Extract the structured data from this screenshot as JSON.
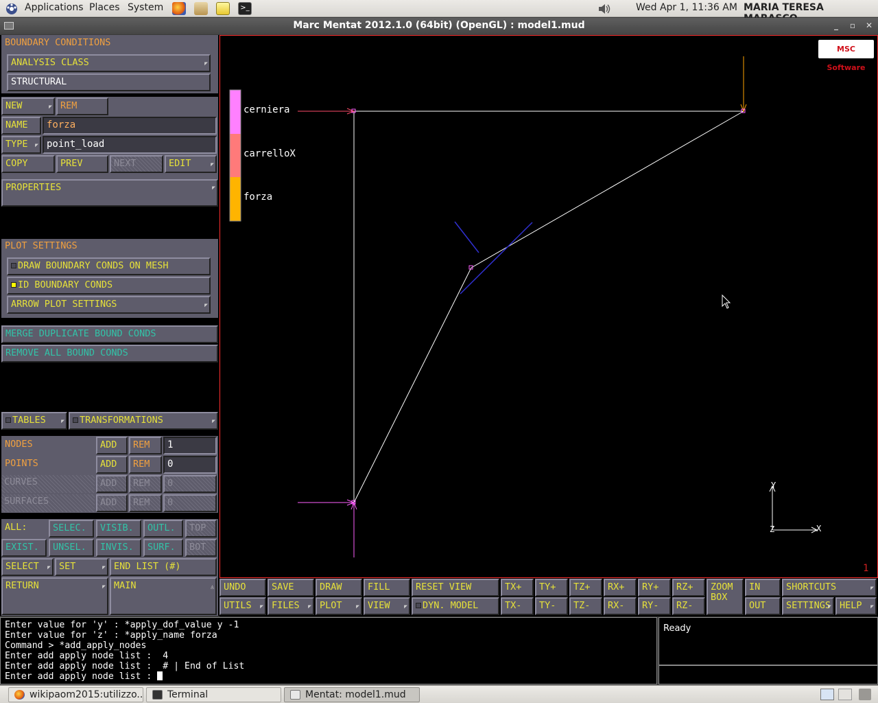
{
  "top_panel": {
    "menus": [
      "Applications",
      "Places",
      "System"
    ],
    "clock": "Wed Apr  1, 11:36 AM",
    "user": "MARIA TERESA MARASCO",
    "launchers": [
      "firefox-icon",
      "file-manager-icon",
      "text-editor-icon",
      "terminal-icon"
    ]
  },
  "window": {
    "title": "Marc Mentat 2012.1.0 (64bit) (OpenGL) : model1.mud"
  },
  "panel": {
    "header": "BOUNDARY CONDITIONS",
    "analysis_class_label": "ANALYSIS CLASS",
    "analysis_class_value": "STRUCTURAL",
    "new": "NEW",
    "rem": "REM",
    "name_label": "NAME",
    "name_value": "forza",
    "type_label": "TYPE",
    "type_value": "point_load",
    "copy": "COPY",
    "prev": "PREV",
    "next": "NEXT",
    "edit": "EDIT",
    "properties": "PROPERTIES",
    "plot_settings": "PLOT SETTINGS",
    "draw_bc": "DRAW BOUNDARY CONDS ON MESH",
    "id_bc": "ID BOUNDARY CONDS",
    "arrow_plot": "ARROW PLOT SETTINGS",
    "merge_dup": "MERGE DUPLICATE BOUND CONDS",
    "remove_all": "REMOVE ALL BOUND CONDS",
    "tables": "TABLES",
    "transformations": "TRANSFORMATIONS",
    "entity_rows": [
      {
        "label": "NODES",
        "add": "ADD",
        "rem": "REM",
        "count": "1"
      },
      {
        "label": "POINTS",
        "add": "ADD",
        "rem": "REM",
        "count": "0"
      },
      {
        "label": "CURVES",
        "add": "ADD",
        "rem": "REM",
        "count": "0"
      },
      {
        "label": "SURFACES",
        "add": "ADD",
        "rem": "REM",
        "count": "0"
      }
    ],
    "all_label": "ALL:",
    "selec": "SELEC.",
    "visib": "VISIB.",
    "outl": "OUTL.",
    "top": "TOP",
    "exist": "EXIST.",
    "unsel": "UNSEL.",
    "invis": "INVIS.",
    "surf": "SURF.",
    "bot": "BOT",
    "select": "SELECT",
    "set": "SET",
    "end_list": "END LIST (#)",
    "return": "RETURN",
    "main": "MAIN"
  },
  "viewport": {
    "legend": [
      {
        "name": "cerniera",
        "color": "#ff80ff"
      },
      {
        "name": "carrelloX",
        "color": "#ff7a7a"
      },
      {
        "name": "forza",
        "color": "#ffb400"
      }
    ],
    "logo": "MSC Software",
    "axis_x": "X",
    "axis_y": "Y",
    "axis_z": "Z",
    "viewport_number": "1"
  },
  "toolbar": {
    "row1": [
      "UNDO",
      "SAVE",
      "DRAW",
      "FILL",
      "RESET VIEW",
      "TX+",
      "TY+",
      "TZ+",
      "RX+",
      "RY+",
      "RZ+",
      "ZOOM BOX",
      "IN",
      "SHORTCUTS"
    ],
    "row2": [
      "UTILS",
      "FILES",
      "PLOT",
      "VIEW",
      "DYN. MODEL",
      "TX-",
      "TY-",
      "TZ-",
      "RX-",
      "RY-",
      "RZ-",
      "OUT",
      "SETTINGS",
      "HELP"
    ]
  },
  "console": {
    "lines": [
      "Enter value for 'y' : *apply_dof_value y -1",
      "Enter value for 'z' : *apply_name forza",
      "Command > *add_apply_nodes",
      "Enter add apply node list :  4",
      "Enter add apply node list :  # | End of List",
      "Enter add apply node list : "
    ],
    "status": "Ready"
  },
  "taskbar": {
    "tasks": [
      "wikipaom2015:utilizzo...",
      "Terminal",
      "Mentat: model1.mud"
    ]
  }
}
